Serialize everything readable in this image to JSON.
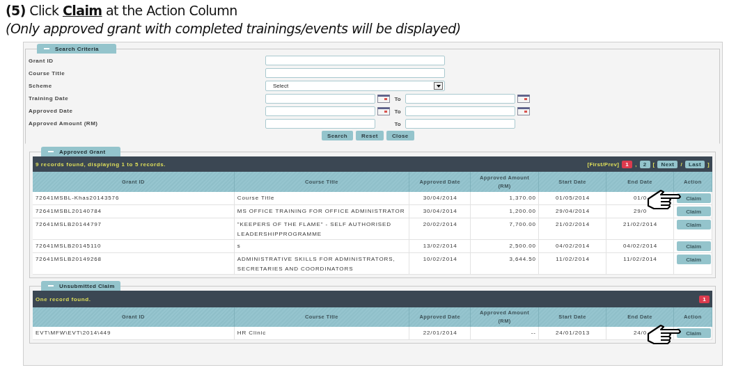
{
  "instruction": {
    "text": "**(5)** Click **Claim** at the Action Column",
    "note": "(Only approved grant with completed trainings/events will be displayed)"
  },
  "search": {
    "legend": "Search Criteria",
    "expanded": true,
    "fields": [
      {
        "kind": "text",
        "label": "Grant ID"
      },
      {
        "kind": "text",
        "label": "Course Title"
      },
      {
        "kind": "select",
        "label": "Scheme",
        "value": "Select"
      },
      {
        "kind": "date_range",
        "label": "Training Date",
        "to": "To"
      },
      {
        "kind": "date_range",
        "label": "Approved Date",
        "to": "To"
      },
      {
        "kind": "range",
        "label": "Approved Amount (RM)",
        "to": "To"
      }
    ],
    "buttons": [
      "Search",
      "Reset",
      "Close"
    ]
  },
  "sections": [
    {
      "legend": "Approved Grant",
      "expanded": true,
      "summary": "9 records found, displaying 1 to 5 records.",
      "pager": [
        {
          "kind": "text",
          "label": "[First/Prev]"
        },
        {
          "kind": "page",
          "label": "1",
          "selected": true
        },
        {
          "kind": "text",
          "label": ","
        },
        {
          "kind": "page",
          "label": "2",
          "selected": false
        },
        {
          "kind": "text",
          "label": "["
        },
        {
          "kind": "page",
          "label": "Next",
          "selected": false
        },
        {
          "kind": "text",
          "label": "/"
        },
        {
          "kind": "page",
          "label": "Last",
          "selected": false
        },
        {
          "kind": "text",
          "label": "]"
        }
      ],
      "columns": [
        "Grant ID",
        "Course Title",
        "Approved Date",
        "Approved Amount (RM)",
        "Start Date",
        "End Date",
        "Action"
      ],
      "rows": [
        {
          "cells": [
            "72641MSBL-Khas20143576",
            "Course Title",
            "30/04/2014",
            "1,370.00",
            "01/05/2014",
            "01/0"
          ],
          "action": "Claim",
          "pointer": true
        },
        {
          "cells": [
            "72641MSBL20140784",
            "MS OFFICE TRAINING FOR OFFICE ADMINISTRATOR",
            "30/04/2014",
            "1,200.00",
            "29/04/2014",
            "29/0"
          ],
          "action": "Claim",
          "pointer": false
        },
        {
          "cells": [
            "72641MSLB20144797",
            "\"KEEPERS OF THE FLAME\" - SELF AUTHORISED LEADERSHIPPROGRAMME",
            "20/02/2014",
            "7,700.00",
            "21/02/2014",
            "21/02/2014"
          ],
          "action": "Claim",
          "pointer": false
        },
        {
          "cells": [
            "72641MSLB20145110",
            "s",
            "13/02/2014",
            "2,500.00",
            "04/02/2014",
            "04/02/2014"
          ],
          "action": "Claim",
          "pointer": false
        },
        {
          "cells": [
            "72641MSLB20149268",
            "ADMINISTRATIVE SKILLS FOR ADMINISTRATORS, SECRETARIES AND COORDINATORS",
            "10/02/2014",
            "3,644.50",
            "11/02/2014",
            "11/02/2014"
          ],
          "action": "Claim",
          "pointer": false
        }
      ]
    },
    {
      "legend": "Unsubmitted Claim",
      "expanded": true,
      "summary": "One record found.",
      "pager": [
        {
          "kind": "page",
          "label": "1",
          "selected": true
        }
      ],
      "columns": [
        "Grant ID",
        "Course Title",
        "Approved Date",
        "Approved Amount (RM)",
        "Start Date",
        "End Date",
        "Action"
      ],
      "rows": [
        {
          "cells": [
            "EVT\\MFW\\EVT\\2014\\449",
            "HR Clinic",
            "22/01/2014",
            "--",
            "24/01/2013",
            "24/0"
          ],
          "action": "Claim",
          "pointer": true
        }
      ]
    }
  ]
}
